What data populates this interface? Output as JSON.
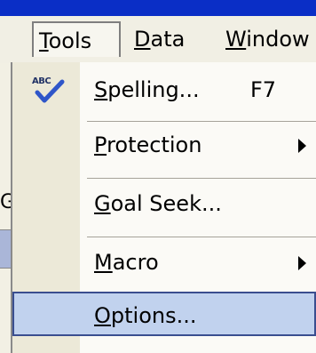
{
  "menubar": {
    "items": [
      {
        "label": "Tools",
        "mnemonic": "T",
        "rest": "ools"
      },
      {
        "label": "Data",
        "mnemonic": "D",
        "rest": "ata"
      },
      {
        "label": "Window",
        "mnemonic": "W",
        "rest": "indow"
      }
    ],
    "active_index": 0
  },
  "left_background": {
    "partial_text": "Gi"
  },
  "tools_menu": {
    "items": [
      {
        "label": "Spelling...",
        "mnemonic": "S",
        "rest": "pelling...",
        "shortcut": "F7",
        "icon": "spelling-check-icon",
        "icon_text": "ABC"
      },
      {
        "label": "Protection",
        "mnemonic": "P",
        "rest": "rotection",
        "submenu": true
      },
      {
        "label": "Goal Seek...",
        "mnemonic": "G",
        "rest": "oal Seek..."
      },
      {
        "label": "Macro",
        "mnemonic": "M",
        "rest": "acro",
        "submenu": true
      },
      {
        "label": "Options...",
        "mnemonic": "O",
        "rest": "ptions...",
        "highlighted": true
      }
    ]
  },
  "colors": {
    "background_blue": "#0a2ec6",
    "menu_background": "#fbfaf6",
    "gutter": "#ece9d8",
    "highlight_fill": "#c1d2ee",
    "highlight_border": "#3a4e8f"
  }
}
